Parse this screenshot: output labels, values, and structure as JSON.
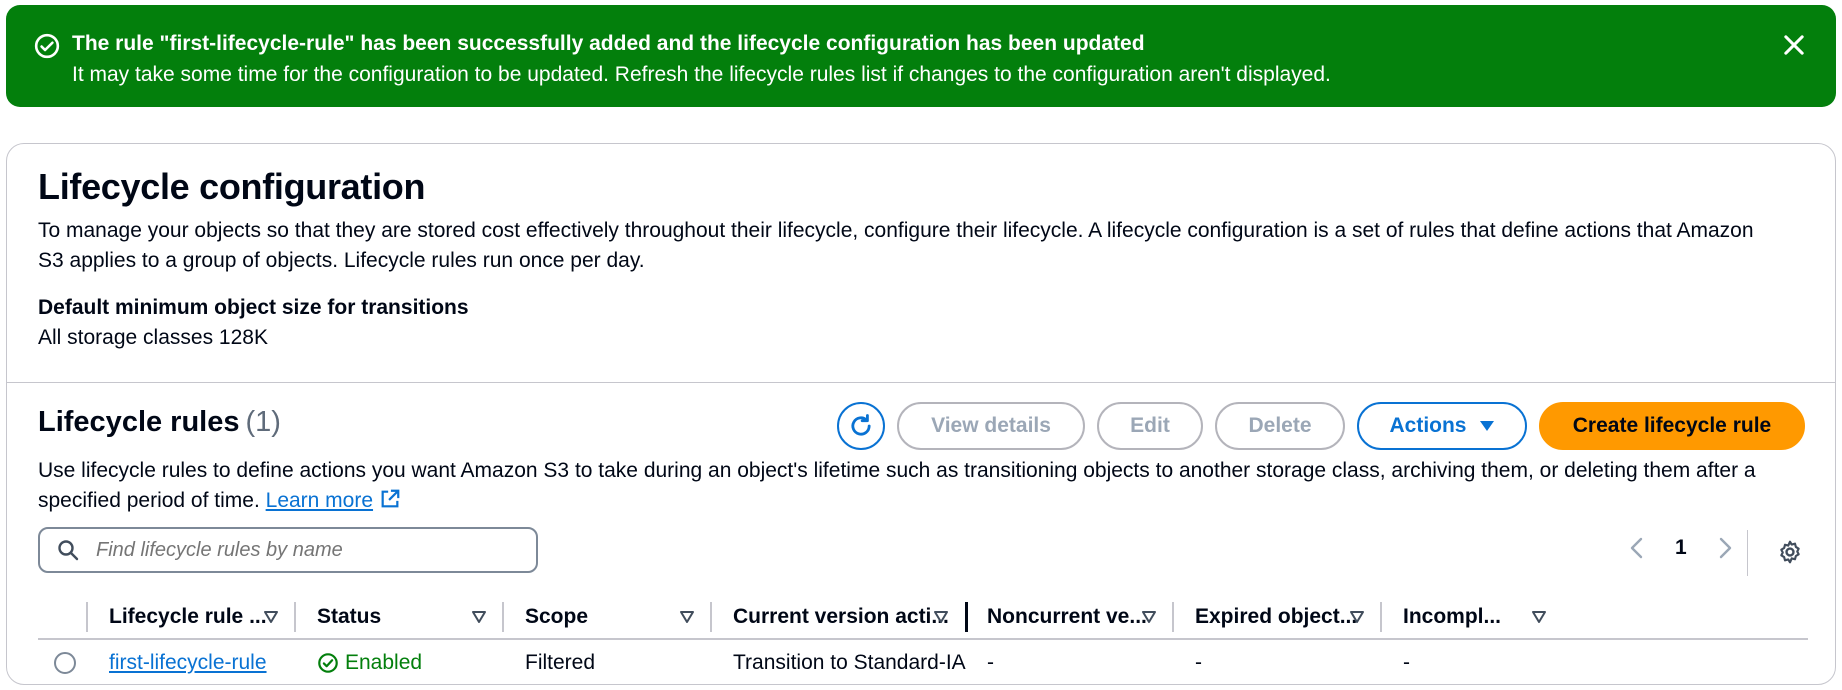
{
  "flash": {
    "title": "The rule \"first-lifecycle-rule\" has been successfully added and the lifecycle configuration has been updated",
    "message": "It may take some time for the configuration to be updated. Refresh the lifecycle rules list if changes to the configuration aren't displayed."
  },
  "page": {
    "title": "Lifecycle configuration",
    "description": "To manage your objects so that they are stored cost effectively throughout their lifecycle, configure their lifecycle. A lifecycle configuration is a set of rules that define actions that Amazon S3 applies to a group of objects. Lifecycle rules run once per day.",
    "min_size_label": "Default minimum object size for transitions",
    "min_size_value": "All storage classes 128K"
  },
  "rules": {
    "title": "Lifecycle rules",
    "count": "(1)",
    "buttons": {
      "view": "View details",
      "edit": "Edit",
      "delete": "Delete",
      "actions": "Actions",
      "create": "Create lifecycle rule"
    },
    "description": "Use lifecycle rules to define actions you want Amazon S3 to take during an object's lifetime such as transitioning objects to another storage class, archiving them, or deleting them after a specified period of time.",
    "learn_more": "Learn more",
    "search_placeholder": "Find lifecycle rules by name",
    "page_number": "1",
    "columns": [
      "Lifecycle rule ...",
      "Status",
      "Scope",
      "Current version acti...",
      "Noncurrent ve...",
      "Expired object...",
      "Incompl..."
    ],
    "rows": [
      {
        "name": "first-lifecycle-rule",
        "status": "Enabled",
        "scope": "Filtered",
        "current_action": "Transition to Standard-IA",
        "noncurrent": "-",
        "expired": "-",
        "incomplete": "-"
      }
    ]
  },
  "colors": {
    "success": "#037f0c",
    "link": "#0972d3",
    "primary": "#ff9900"
  }
}
